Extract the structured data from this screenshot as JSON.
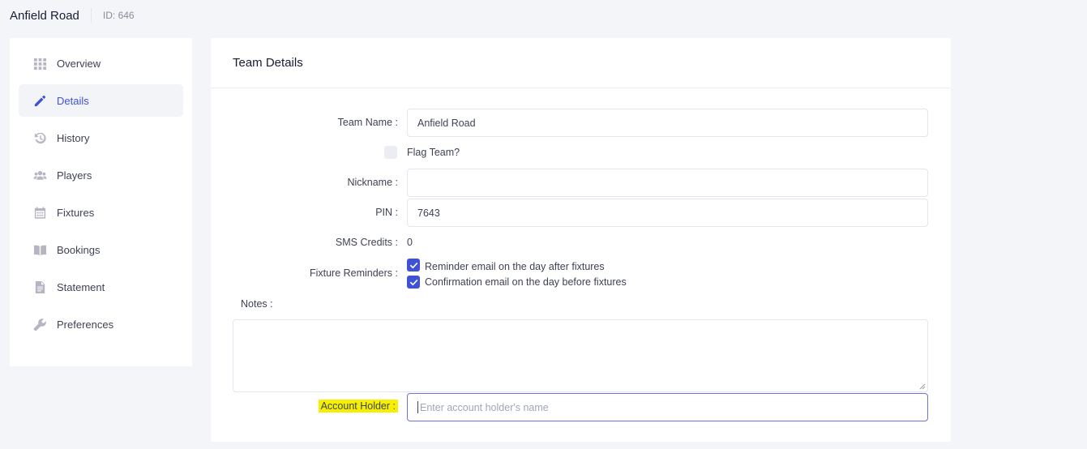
{
  "header": {
    "title": "Anfield Road",
    "id_label": "ID: 646"
  },
  "sidebar": {
    "items": [
      {
        "label": "Overview",
        "icon": "grid-icon",
        "active": false
      },
      {
        "label": "Details",
        "icon": "pencil-icon",
        "active": true
      },
      {
        "label": "History",
        "icon": "history-icon",
        "active": false
      },
      {
        "label": "Players",
        "icon": "users-icon",
        "active": false
      },
      {
        "label": "Fixtures",
        "icon": "calendar-icon",
        "active": false
      },
      {
        "label": "Bookings",
        "icon": "book-icon",
        "active": false
      },
      {
        "label": "Statement",
        "icon": "document-icon",
        "active": false
      },
      {
        "label": "Preferences",
        "icon": "wrench-icon",
        "active": false
      }
    ]
  },
  "card": {
    "title": "Team Details"
  },
  "form": {
    "team_name_label": "Team Name :",
    "team_name_value": "Anfield Road",
    "flag_team_label": "Flag Team?",
    "flag_team_checked": false,
    "nickname_label": "Nickname :",
    "nickname_value": "",
    "pin_label": "PIN :",
    "pin_value": "7643",
    "sms_credits_label": "SMS Credits :",
    "sms_credits_value": "0",
    "fixture_reminders_label": "Fixture Reminders :",
    "reminder_after_label": "Reminder email on the day after fixtures",
    "reminder_after_checked": true,
    "confirmation_before_label": "Confirmation email on the day before fixtures",
    "confirmation_before_checked": true,
    "notes_label": "Notes :",
    "notes_value": "",
    "account_holder_label": "Account Holder :",
    "account_holder_placeholder": "Enter account holder's name",
    "highlight_color": "#f6f000",
    "accent_color": "#3f51d6"
  }
}
